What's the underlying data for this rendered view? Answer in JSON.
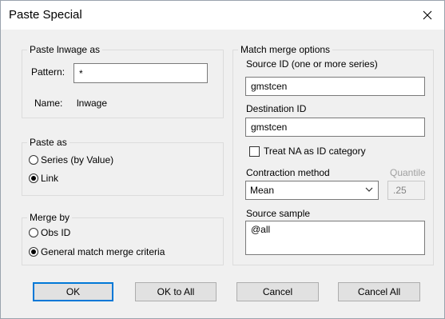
{
  "window": {
    "title": "Paste Special"
  },
  "paste_group": {
    "title": "Paste lnwage as",
    "pattern_label": "Pattern:",
    "pattern_value": "*",
    "name_label": "Name:",
    "name_value": "lnwage"
  },
  "paste_as": {
    "title": "Paste as",
    "options": [
      {
        "label": "Series (by Value)",
        "selected": false
      },
      {
        "label": "Link",
        "selected": true
      }
    ]
  },
  "merge_by": {
    "title": "Merge by",
    "options": [
      {
        "label": "Obs ID",
        "selected": false
      },
      {
        "label": "General match merge criteria",
        "selected": true
      }
    ]
  },
  "match_merge": {
    "title": "Match merge options",
    "source_id_label": "Source ID (one or more series)",
    "source_id_value": "gmstcen",
    "destination_id_label": "Destination ID",
    "destination_id_value": "gmstcen",
    "treat_na_label": "Treat NA as ID category",
    "treat_na_checked": false,
    "contraction_label": "Contraction method",
    "contraction_value": "Mean",
    "quantile_label": "Quantile",
    "quantile_value": ".25",
    "source_sample_label": "Source sample",
    "source_sample_value": "@all"
  },
  "buttons": {
    "ok": "OK",
    "ok_to_all": "OK to All",
    "cancel": "Cancel",
    "cancel_all": "Cancel All"
  }
}
